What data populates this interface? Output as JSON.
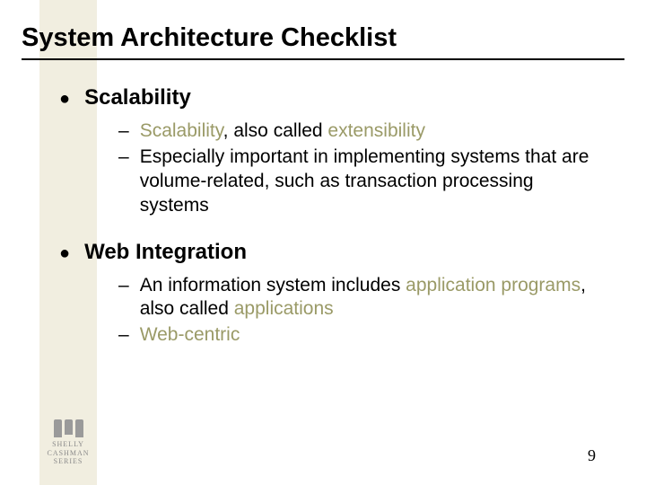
{
  "title": "System Architecture Checklist",
  "bullets": [
    {
      "heading": "Scalability",
      "subs": [
        {
          "pre": "",
          "kw1": "Scalability",
          "mid": ", also called ",
          "kw2": "extensibility",
          "post": ""
        },
        {
          "pre": "Especially important in implementing systems that are volume-related, such as transaction processing systems",
          "kw1": "",
          "mid": "",
          "kw2": "",
          "post": ""
        }
      ]
    },
    {
      "heading": "Web Integration",
      "subs": [
        {
          "pre": "An information system includes ",
          "kw1": "application programs",
          "mid": ", also called ",
          "kw2": "applications",
          "post": ""
        },
        {
          "pre": "",
          "kw1": "Web-centric",
          "mid": "",
          "kw2": "",
          "post": ""
        }
      ]
    }
  ],
  "page_number": "9",
  "logo": {
    "l1": "SHELLY",
    "l2": "CASHMAN",
    "l3": "SERIES"
  }
}
